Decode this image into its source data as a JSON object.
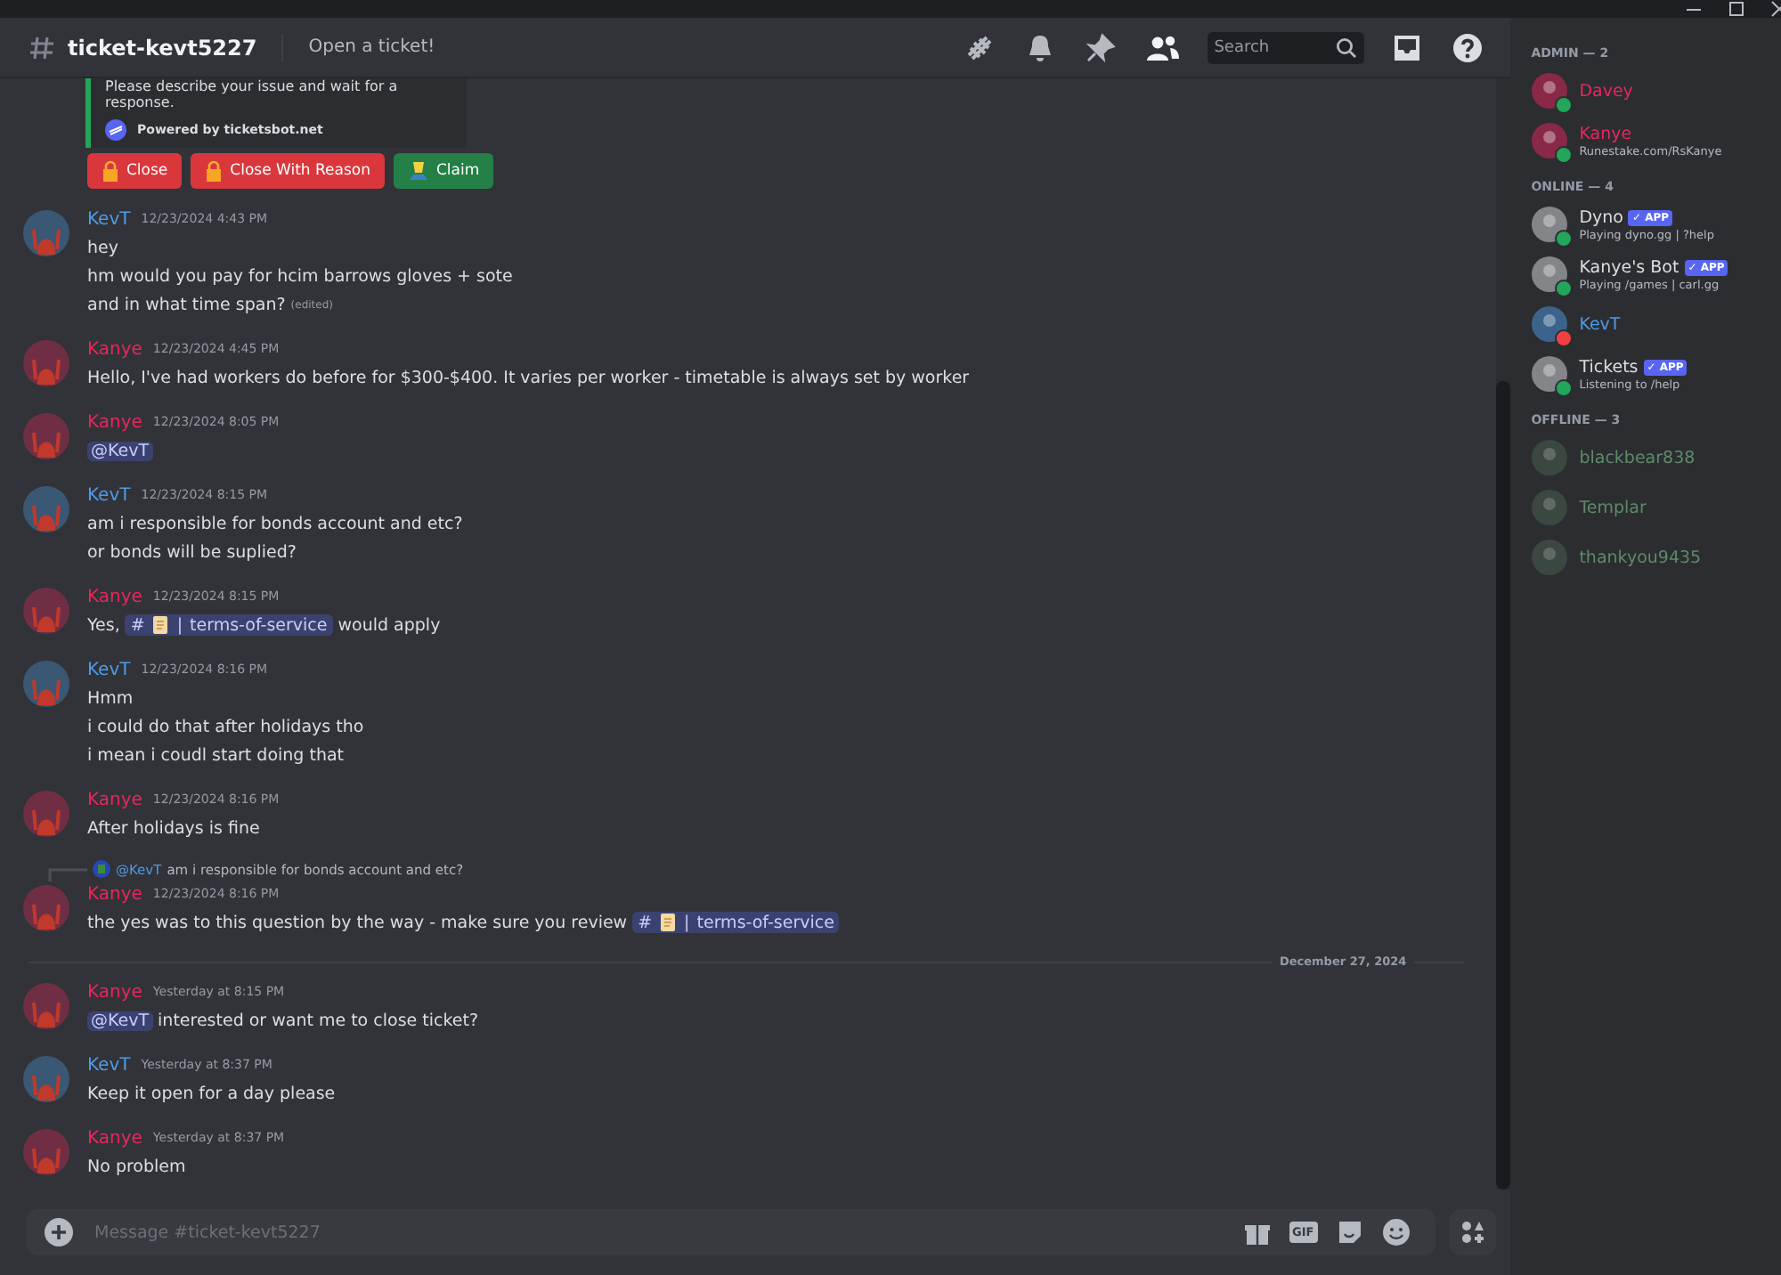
{
  "channel": {
    "name": "ticket-kevt5227",
    "topic": "Open a ticket!"
  },
  "header": {
    "search": {
      "placeholder": "Search"
    }
  },
  "embed": {
    "text": "Please describe your issue and wait for a response.",
    "footer": "Powered by ticketsbot.net"
  },
  "buttons": [
    {
      "label": "Close",
      "kind": "danger"
    },
    {
      "label": "Close With Reason",
      "kind": "danger"
    },
    {
      "label": "Claim",
      "kind": "success"
    }
  ],
  "messages": [
    {
      "author": "KevT",
      "color": "#4e9ae6",
      "time": "12/23/2024 4:43 PM",
      "lines": [
        [
          {
            "kind": "text",
            "text": "hey"
          }
        ],
        [
          {
            "kind": "text",
            "text": "hm would you pay for hcim barrows gloves + sote"
          }
        ],
        [
          {
            "kind": "text",
            "text": "and in what time span?"
          },
          {
            "kind": "edited",
            "text": "(edited)"
          }
        ]
      ]
    },
    {
      "author": "Kanye",
      "color": "#e8265e",
      "time": "12/23/2024 4:45 PM",
      "lines": [
        [
          {
            "kind": "text",
            "text": "Hello, I've had workers do before for $300-$400. It varies per worker - timetable is always set by worker"
          }
        ]
      ]
    },
    {
      "author": "Kanye",
      "color": "#e8265e",
      "time": "12/23/2024 8:05 PM",
      "lines": [
        [
          {
            "kind": "mention",
            "text": "@KevT"
          }
        ]
      ]
    },
    {
      "author": "KevT",
      "color": "#4e9ae6",
      "time": "12/23/2024 8:15 PM",
      "lines": [
        [
          {
            "kind": "text",
            "text": "am i responsible for bonds account and etc?"
          }
        ],
        [
          {
            "kind": "text",
            "text": "or bonds will be suplied?"
          }
        ]
      ]
    },
    {
      "author": "Kanye",
      "color": "#e8265e",
      "time": "12/23/2024 8:15 PM",
      "lines": [
        [
          {
            "kind": "text",
            "text": "Yes,"
          },
          {
            "kind": "channel",
            "hash": "#",
            "sep": "|",
            "name": "terms-of-service"
          },
          {
            "kind": "text",
            "text": "would apply"
          }
        ]
      ]
    },
    {
      "author": "KevT",
      "color": "#4e9ae6",
      "time": "12/23/2024 8:16 PM",
      "lines": [
        [
          {
            "kind": "text",
            "text": "Hmm"
          }
        ],
        [
          {
            "kind": "text",
            "text": "i could do that after holidays tho"
          }
        ],
        [
          {
            "kind": "text",
            "text": "i mean i coudl start doing that"
          }
        ]
      ]
    },
    {
      "author": "Kanye",
      "color": "#e8265e",
      "time": "12/23/2024 8:16 PM",
      "lines": [
        [
          {
            "kind": "text",
            "text": "After holidays is fine"
          }
        ]
      ]
    },
    {
      "author": "Kanye",
      "color": "#e8265e",
      "time": "12/23/2024 8:16 PM",
      "reply": {
        "author": "@KevT",
        "text": "am i responsible for bonds account and etc?"
      },
      "lines": [
        [
          {
            "kind": "text",
            "text": "the yes was to this question by the way - make sure you review"
          },
          {
            "kind": "channel",
            "hash": "#",
            "sep": "|",
            "name": "terms-of-service"
          }
        ]
      ]
    },
    {
      "divider": "December 27, 2024",
      "author": "Kanye",
      "color": "#e8265e",
      "time": "Yesterday at 8:15 PM",
      "lines": [
        [
          {
            "kind": "mention",
            "text": "@KevT"
          },
          {
            "kind": "text",
            "text": "interested or want me to close ticket?"
          }
        ]
      ]
    },
    {
      "author": "KevT",
      "color": "#4e9ae6",
      "time": "Yesterday at 8:37 PM",
      "lines": [
        [
          {
            "kind": "text",
            "text": "Keep it open for a day please"
          }
        ]
      ]
    },
    {
      "author": "Kanye",
      "color": "#e8265e",
      "time": "Yesterday at 8:37 PM",
      "lines": [
        [
          {
            "kind": "text",
            "text": "No problem"
          }
        ]
      ]
    }
  ],
  "composer": {
    "placeholder": "Message #ticket-kevt5227",
    "gif_label": "GIF"
  },
  "member_groups": [
    {
      "title": "ADMIN — 2",
      "members": [
        {
          "name": "Davey",
          "color": "#e8265e",
          "online": true,
          "busy": false
        },
        {
          "name": "Kanye",
          "color": "#e8265e",
          "online": true,
          "busy": false,
          "activity": "Runestake.com/RsKanye"
        }
      ]
    },
    {
      "title": "ONLINE — 4",
      "members": [
        {
          "name": "Dyno",
          "color": "#dbdee1",
          "online": true,
          "busy": false,
          "badge": "✓ APP",
          "activity": "Playing dyno.gg | ?help"
        },
        {
          "name": "Kanye's Bot",
          "color": "#dbdee1",
          "online": true,
          "busy": false,
          "badge": "✓ APP",
          "activity": "Playing /games | carl.gg"
        },
        {
          "name": "KevT",
          "color": "#4e9ae6",
          "online": true,
          "busy": true
        },
        {
          "name": "Tickets",
          "color": "#dbdee1",
          "online": true,
          "busy": false,
          "badge": "✓ APP",
          "activity": "Listening to /help"
        }
      ]
    },
    {
      "title": "OFFLINE — 3",
      "members": [
        {
          "name": "blackbear838",
          "color": "#5f8a68",
          "online": false,
          "busy": false
        },
        {
          "name": "Templar",
          "color": "#5f8a68",
          "online": false,
          "busy": false
        },
        {
          "name": "thankyou9435",
          "color": "#5f8a68",
          "online": false,
          "busy": false
        }
      ]
    }
  ]
}
